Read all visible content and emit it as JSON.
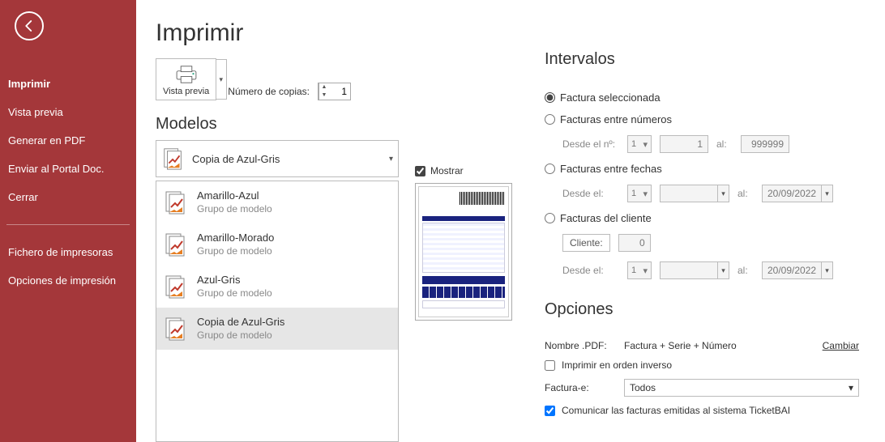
{
  "page_title": "Imprimir",
  "sidebar": {
    "items": [
      "Imprimir",
      "Vista previa",
      "Generar en PDF",
      "Enviar al Portal Doc.",
      "Cerrar"
    ],
    "items2": [
      "Fichero de impresoras",
      "Opciones de impresión"
    ]
  },
  "preview_btn_label": "Vista previa",
  "copies_label": "Número de copias:",
  "copies_value": "1",
  "models_title": "Modelos",
  "selected_model": "Copia de Azul-Gris",
  "models_sub": "Grupo de modelo",
  "models": [
    "Amarillo-Azul",
    "Amarillo-Morado",
    "Azul-Gris",
    "Copia de Azul-Gris"
  ],
  "mostrar_label": "Mostrar",
  "intervals": {
    "title": "Intervalos",
    "r1": "Factura seleccionada",
    "r2": "Facturas entre números",
    "r2_from": "Desde el nº:",
    "r2_v1": "1",
    "r2_v2": "1",
    "al": "al:",
    "r2_max": "999999",
    "r3": "Facturas entre fechas",
    "desde": "Desde el:",
    "sel1": "1",
    "date": "20/09/2022",
    "r4": "Facturas del cliente",
    "cliente_lbl": "Cliente:",
    "cliente_val": "0"
  },
  "options": {
    "title": "Opciones",
    "pdf_lbl": "Nombre .PDF:",
    "pdf_val": "Factura + Serie + Número",
    "cambiar": "Cambiar",
    "reverse": "Imprimir en orden inverso",
    "fe_lbl": "Factura-e:",
    "fe_val": "Todos",
    "tbai": "Comunicar las facturas emitidas al sistema TicketBAI"
  }
}
